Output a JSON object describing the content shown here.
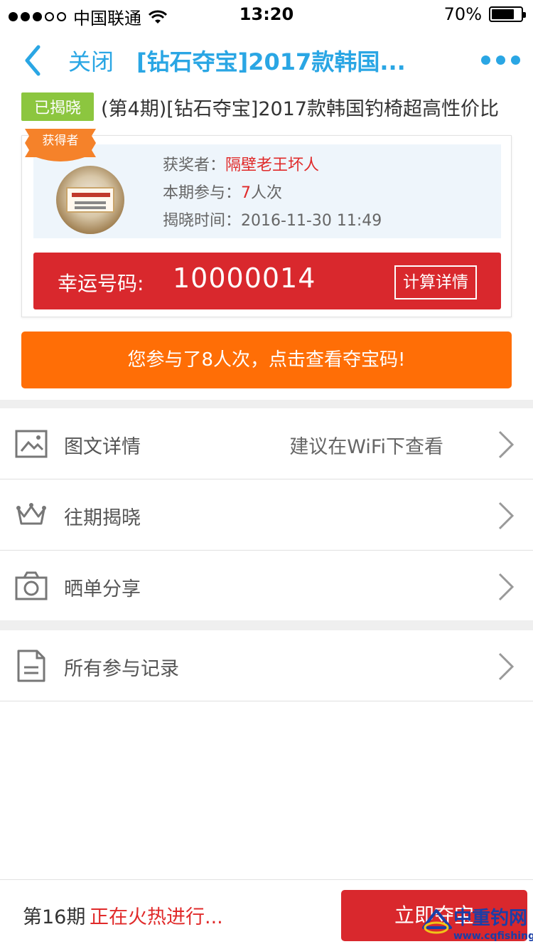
{
  "status_bar": {
    "carrier": "中国联通",
    "time": "13:20",
    "battery": "70%"
  },
  "nav": {
    "close_label": "关闭",
    "title": "[钻石夺宝]2017款韩国..."
  },
  "product": {
    "tag": "已揭晓",
    "title": "(第4期)[钻石夺宝]2017款韩国钓椅超高性价比"
  },
  "winner": {
    "badge": "获得者",
    "winner_label": "获奖者：",
    "winner_name": "隔壁老王坏人",
    "participation_label": "本期参与：",
    "participation_count": "7",
    "participation_unit": "人次",
    "reveal_label": "揭晓时间：",
    "reveal_time": "2016-11-30 11:49",
    "lucky_label": "幸运号码:",
    "lucky_number": "10000014",
    "calc_button": "计算详情"
  },
  "join_button": "您参与了8人次，点击查看夺宝码!",
  "menu": {
    "details": {
      "label": "图文详情",
      "hint": "建议在WiFi下查看"
    },
    "history": {
      "label": "往期揭晓"
    },
    "share": {
      "label": "晒单分享"
    },
    "records": {
      "label": "所有参与记录"
    }
  },
  "bottom": {
    "issue": "第16期",
    "status": "正在火热进行...",
    "button": "立即夺宝"
  },
  "watermark": {
    "text": "中重钓网",
    "url": "www.cqfishing.net"
  },
  "colors": {
    "accent": "#2aa6e4",
    "red": "#d9282d",
    "orange": "#ff6e06",
    "tag_green": "#8cc63f"
  }
}
